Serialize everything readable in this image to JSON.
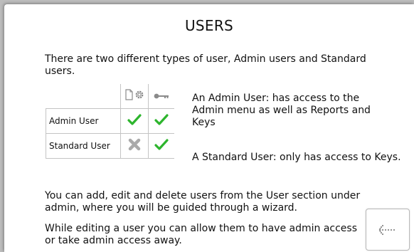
{
  "dialog": {
    "title": "USERS",
    "intro": "There are two different types of user, Admin users and Standard users.",
    "table": {
      "columns": [
        "document-gear-icon",
        "key-icon"
      ],
      "rows": [
        {
          "label": "Admin User",
          "admin_menu": "check-icon",
          "keys": "check-icon"
        },
        {
          "label": "Standard User",
          "admin_menu": "cross-icon",
          "keys": "check-icon"
        }
      ]
    },
    "admin_description": "An Admin User:   has access to the Admin menu as well as Reports and Keys",
    "standard_description": "A Standard User:   only has access to Keys.",
    "paragraph_1": "You can add, edit and delete users from the User section under admin, where you will be guided through a wizard.",
    "paragraph_2": "While editing a user you can allow them to have admin access or take admin access away.",
    "back_button_icon": "dotted-back-arrow-icon"
  },
  "colors": {
    "check": "#2db52d",
    "cross": "#aaaaaa",
    "icon_gray": "#8a8a8a",
    "background": "#bdbdbd"
  }
}
